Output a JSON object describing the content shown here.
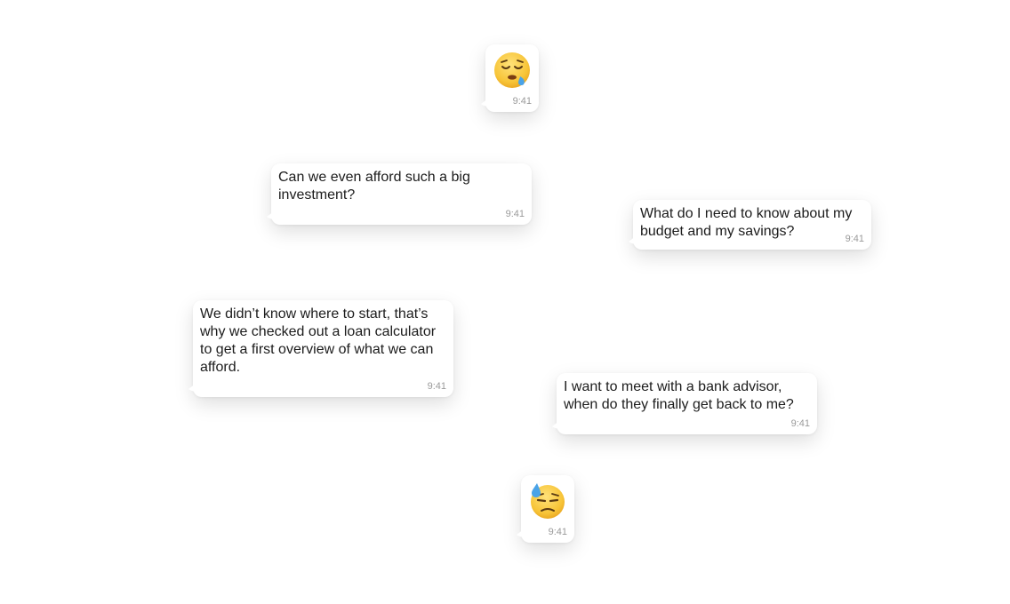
{
  "messages": [
    {
      "type": "emoji",
      "emoji_icon": "sleepy-face-icon",
      "time": "9:41"
    },
    {
      "type": "text",
      "text": "Can we even afford such a big investment?",
      "time": "9:41"
    },
    {
      "type": "text",
      "text": "What do I need to know about my budget and my savings?",
      "time": "9:41"
    },
    {
      "type": "text",
      "text": "We didn’t know where to start, that’s why we checked out a loan calculator to get a first overview of what we can afford.",
      "time": "9:41"
    },
    {
      "type": "text",
      "text": "I want to meet with a bank advisor, when do they finally get back to me?",
      "time": "9:41"
    },
    {
      "type": "emoji",
      "emoji_icon": "downcast-face-with-sweat-icon",
      "time": "9:41"
    }
  ],
  "colors": {
    "background": "#ffffff",
    "bubble": "#ffffff",
    "text": "#1c1c1c",
    "timestamp": "#9a9a9a",
    "emoji_face": "#f7c437",
    "emoji_drop": "#4aa3e8"
  }
}
